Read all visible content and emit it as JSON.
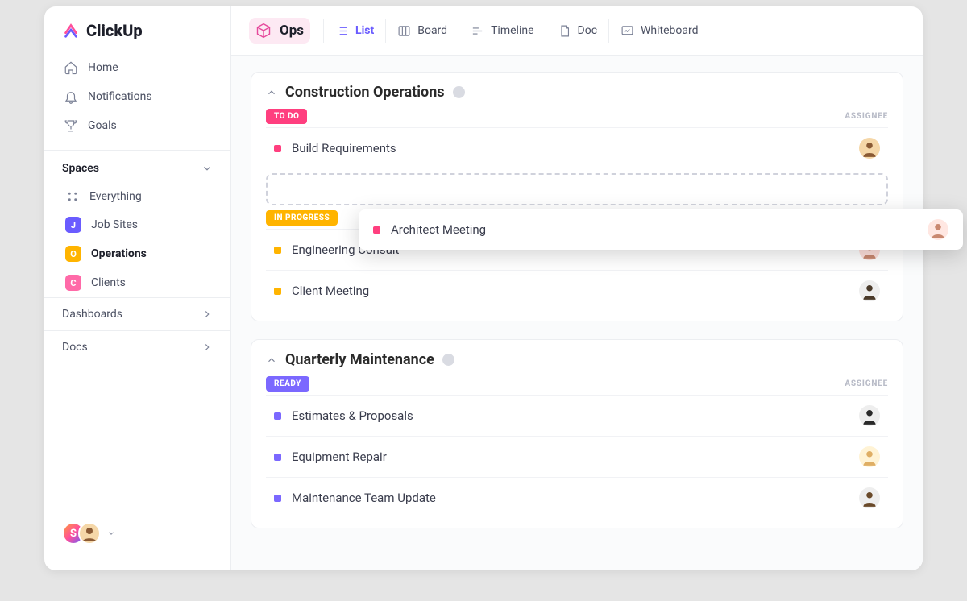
{
  "brand": "ClickUp",
  "nav": {
    "home": "Home",
    "notifications": "Notifications",
    "goals": "Goals"
  },
  "spaces_header": "Spaces",
  "spaces": {
    "everything": "Everything",
    "jobsites": {
      "label": "Job Sites",
      "initial": "J",
      "color": "#6a5cff"
    },
    "operations": {
      "label": "Operations",
      "initial": "O",
      "color": "#ffb400"
    },
    "clients": {
      "label": "Clients",
      "initial": "C",
      "color": "#ff6aa8"
    }
  },
  "collapsibles": {
    "dashboards": "Dashboards",
    "docs": "Docs"
  },
  "toolbar": {
    "space_label": "Ops",
    "views": {
      "list": "List",
      "board": "Board",
      "timeline": "Timeline",
      "doc": "Doc",
      "whiteboard": "Whiteboard"
    }
  },
  "labels": {
    "assignee": "ASSIGNEE"
  },
  "groups": [
    {
      "title": "Construction Operations",
      "statuses": [
        {
          "name": "TO DO",
          "color": "#ff3f7f",
          "square": "#ff3f7f",
          "tasks": [
            {
              "name": "Build Requirements",
              "avatar_bg": "#f5d7a8",
              "avatar_face": "#8a5a34"
            }
          ],
          "has_dropzone": true
        },
        {
          "name": "IN PROGRESS",
          "color": "#ffb400",
          "square": "#ffb400",
          "tasks": [
            {
              "name": "Engineering Consult",
              "avatar_bg": "#ffe0dc",
              "avatar_face": "#c98870"
            },
            {
              "name": "Client Meeting",
              "avatar_bg": "#eee",
              "avatar_face": "#4a3a2a"
            }
          ]
        }
      ]
    },
    {
      "title": "Quarterly Maintenance",
      "statuses": [
        {
          "name": "READY",
          "color": "#7b68ff",
          "square": "#7b68ff",
          "tasks": [
            {
              "name": "Estimates & Proposals",
              "avatar_bg": "#eee",
              "avatar_face": "#2a2a2a"
            },
            {
              "name": "Equipment Repair",
              "avatar_bg": "#fff3d5",
              "avatar_face": "#dfae64"
            },
            {
              "name": "Maintenance Team Update",
              "avatar_bg": "#eee",
              "avatar_face": "#6a4a2a"
            }
          ]
        }
      ]
    }
  ],
  "dragged_task": {
    "name": "Architect Meeting",
    "square": "#ff3f7f",
    "avatar_bg": "#ffe7e2",
    "avatar_face": "#c98870"
  },
  "footer_avatars": [
    {
      "initial": "S",
      "bg": "linear-gradient(135deg,#ff5ca0,#ffb400,#6a5cff)"
    },
    {
      "face": "#8a5a34",
      "bg": "#f5d7a8"
    }
  ]
}
